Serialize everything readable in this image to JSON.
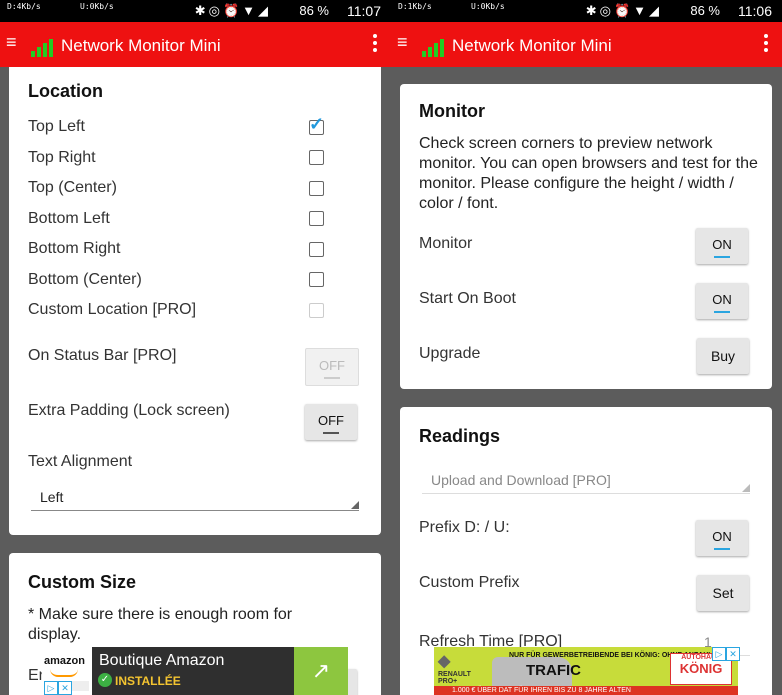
{
  "left": {
    "status": {
      "down": "D:4Kb/s",
      "up": "U:0Kb/s",
      "battery": "86 %",
      "time": "11:07"
    },
    "appbar": {
      "title": "Network Monitor Mini"
    },
    "location": {
      "title": "Location",
      "items": [
        {
          "label": "Top Left",
          "checked": true
        },
        {
          "label": "Top Right",
          "checked": false
        },
        {
          "label": "Top (Center)",
          "checked": false
        },
        {
          "label": "Bottom Left",
          "checked": false
        },
        {
          "label": "Bottom Right",
          "checked": false
        },
        {
          "label": "Bottom (Center)",
          "checked": false
        },
        {
          "label": "Custom Location [PRO]",
          "checked": false
        }
      ],
      "status_bar": {
        "label": "On Status Bar [PRO]",
        "state": "OFF"
      },
      "extra_padding": {
        "label": "Extra Padding (Lock screen)",
        "state": "OFF"
      },
      "text_alignment": {
        "label": "Text Alignment",
        "value": "Left"
      }
    },
    "custom_size": {
      "title": "Custom Size",
      "note": "* Make sure there is enough room for display.",
      "partial": "En"
    },
    "ad": {
      "brand": "amazon",
      "title": "Boutique Amazon",
      "status": "INSTALLÉE"
    }
  },
  "right": {
    "status": {
      "down": "D:1Kb/s",
      "up": "U:0Kb/s",
      "battery": "86 %",
      "time": "11:06"
    },
    "appbar": {
      "title": "Network Monitor Mini"
    },
    "monitor": {
      "title": "Monitor",
      "description": "Check screen corners to preview network monitor. You can open browsers and test for the monitor. Please configure the height / width / color / font.",
      "monitor_toggle": {
        "label": "Monitor",
        "state": "ON"
      },
      "boot_toggle": {
        "label": "Start On Boot",
        "state": "ON"
      },
      "upgrade": {
        "label": "Upgrade",
        "button": "Buy"
      }
    },
    "readings": {
      "title": "Readings",
      "mode": "Upload and Download [PRO]",
      "prefix": {
        "label": "Prefix D: / U:",
        "state": "ON"
      },
      "custom_prefix": {
        "label": "Custom Prefix",
        "button": "Set"
      },
      "refresh": {
        "label": "Refresh Time [PRO]",
        "value": "1"
      }
    },
    "ad": {
      "brand": "RENAULT PRO+",
      "line1": "NUR FÜR GEWERBETREIBENDE BEI KÖNIG: OHNE ANZAHLUNG",
      "line2": "TRAFIC",
      "dealer_top": "AUTOHAUS",
      "dealer": "KÖNIG",
      "bottom": "1.000 € ÜBER DAT FÜR IHREN BIS ZU 8 JAHRE ALTEN"
    }
  }
}
